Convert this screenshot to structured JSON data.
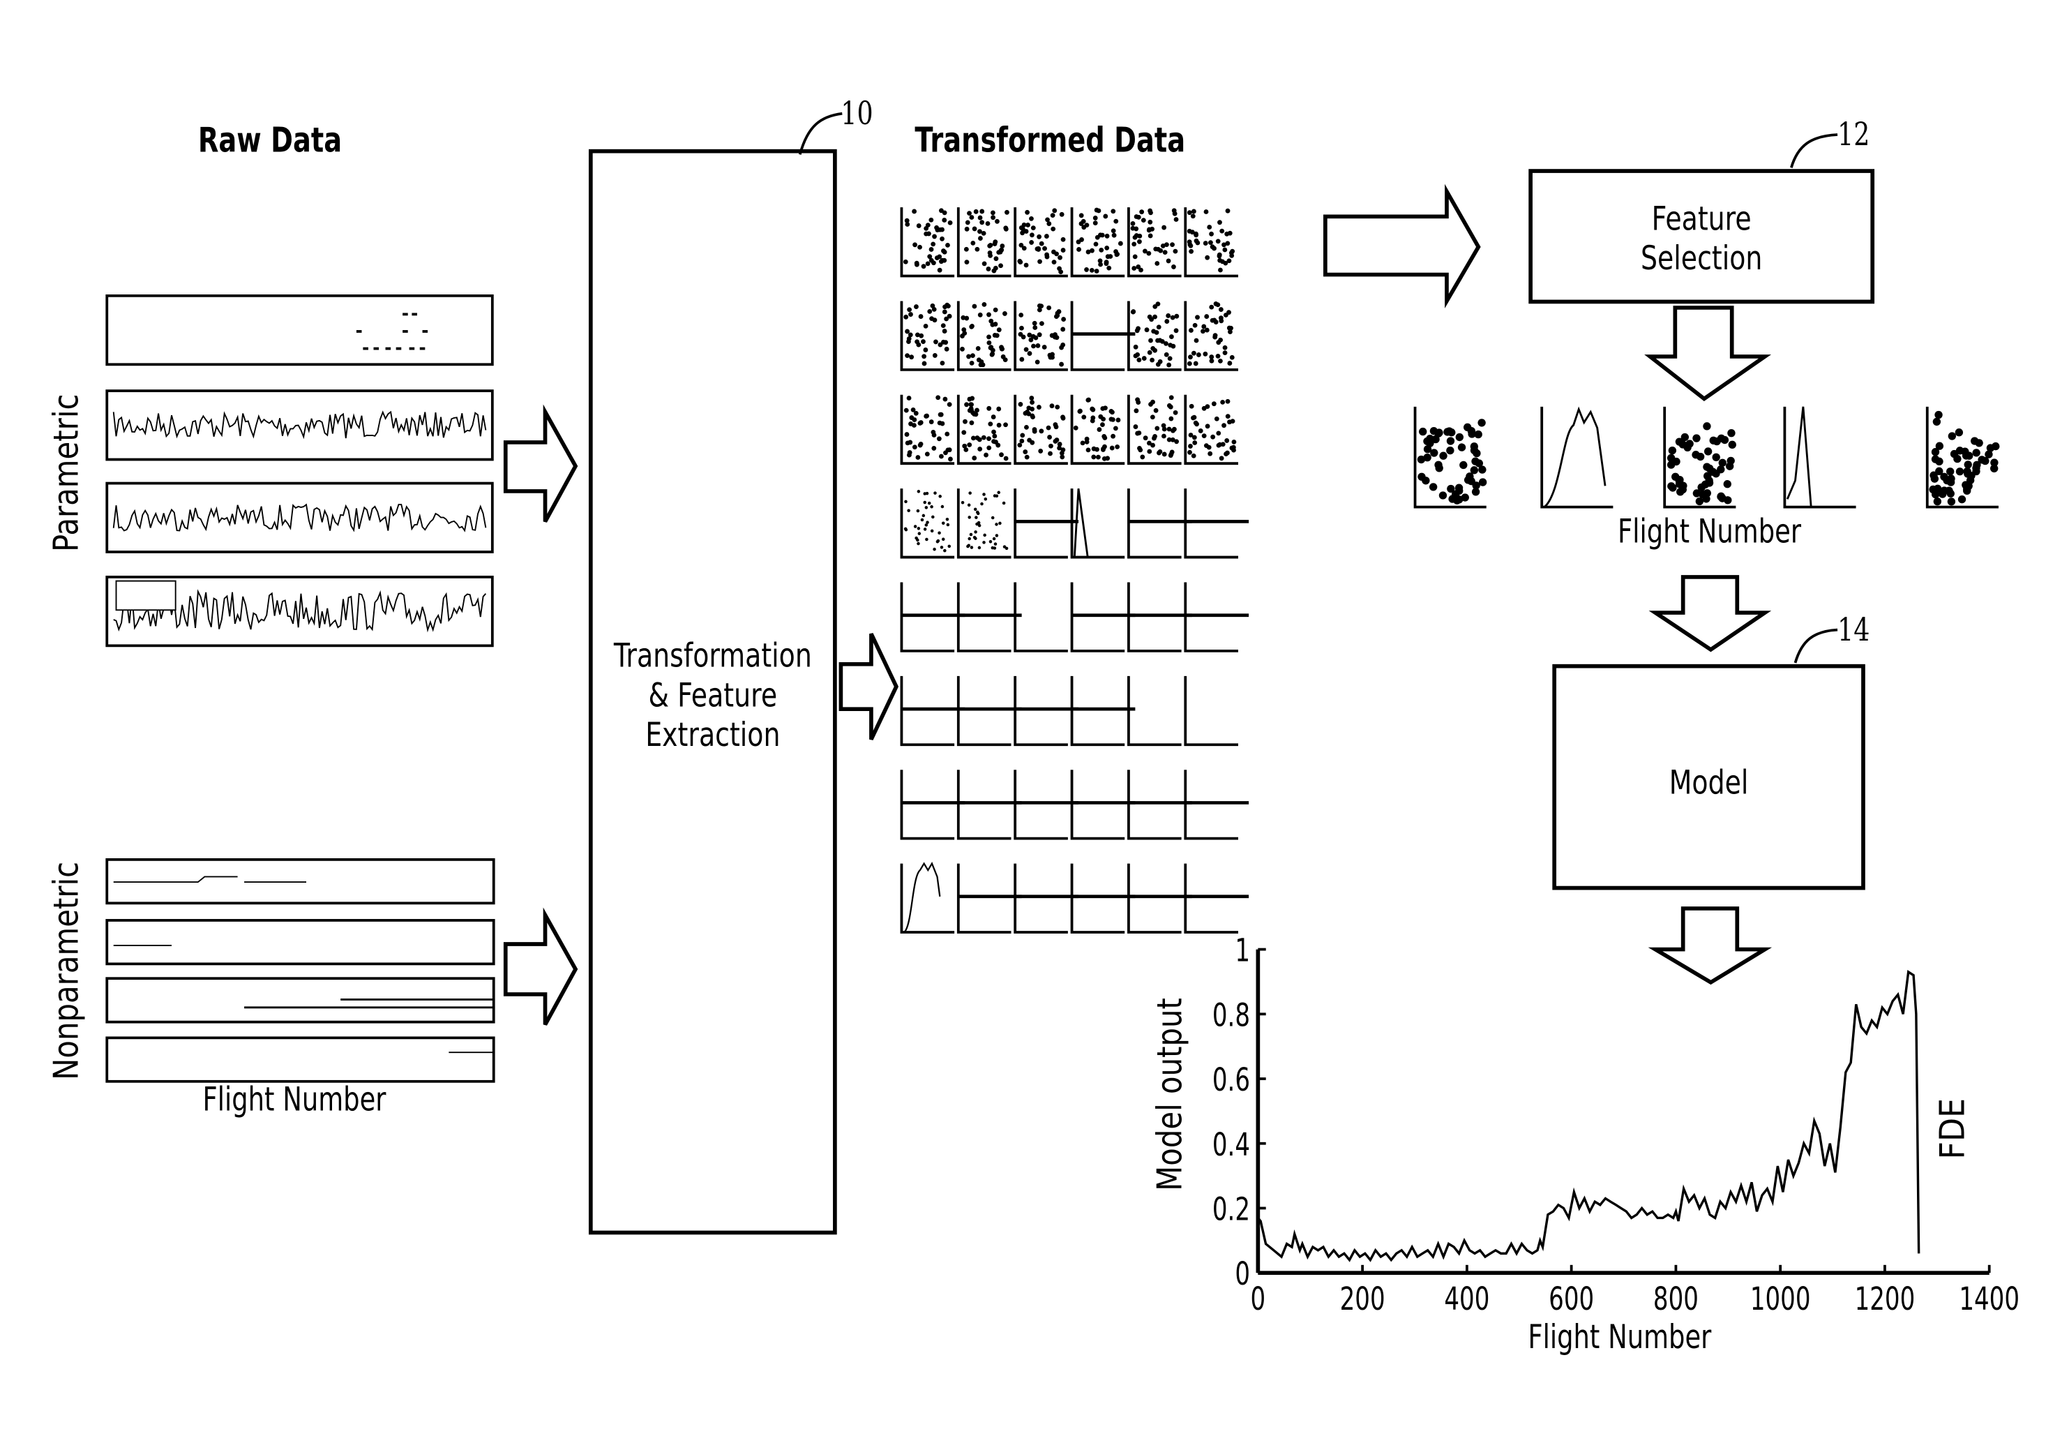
{
  "raw_data": {
    "title": "Raw Data",
    "parametric_label": "Parametric",
    "nonparametric_label": "Nonparametric",
    "xlabel": "Flight Number",
    "parametric_panels": 4,
    "nonparametric_panels": 4
  },
  "transform_block": {
    "ref": "10",
    "lines": [
      "Transformation",
      "& Feature",
      "Extraction"
    ]
  },
  "transformed_data": {
    "title": "Transformed Data",
    "grid_rows": 8,
    "grid_cols": 6,
    "cells": [
      [
        "scatter",
        "scatter",
        "scatter",
        "scatter",
        "scatter",
        "scatter"
      ],
      [
        "scatter",
        "scatter",
        "scatter",
        "flat",
        "scatter",
        "scatter"
      ],
      [
        "scatter",
        "scatter",
        "scatter",
        "scatter",
        "scatter",
        "scatter"
      ],
      [
        "noisy",
        "noisy",
        "flat",
        "spike",
        "flat",
        "flat"
      ],
      [
        "flat",
        "flat",
        "empty",
        "flat",
        "flat",
        "flat"
      ],
      [
        "flat",
        "flat",
        "flat",
        "flat",
        "empty",
        "empty"
      ],
      [
        "flat",
        "flat",
        "flat",
        "flat",
        "flat",
        "flat"
      ],
      [
        "hump",
        "flat",
        "flat",
        "flat",
        "flat",
        "flat"
      ]
    ]
  },
  "feature_selection": {
    "ref": "12",
    "lines": [
      "Feature",
      "Selection"
    ],
    "selected_features": [
      "scatter",
      "hump",
      "scatter",
      "spike",
      "scatter"
    ],
    "xlabel": "Flight Number"
  },
  "model": {
    "ref": "14",
    "label": "Model"
  },
  "chart_data": {
    "type": "line",
    "title": "",
    "xlabel": "Flight Number",
    "ylabel": "Model output",
    "xlim": [
      0,
      1400
    ],
    "ylim": [
      0,
      1
    ],
    "xticks": [
      "0",
      "200",
      "400",
      "600",
      "800",
      "1000",
      "1200",
      "1400"
    ],
    "yticks": [
      "0",
      "0.2",
      "0.4",
      "0.6",
      "0.8",
      "1"
    ],
    "annotation": "FDE",
    "annotation_x": 1275,
    "grid": false,
    "series": [
      {
        "name": "Model output",
        "x": [
          0,
          5,
          15,
          30,
          45,
          55,
          65,
          70,
          80,
          85,
          95,
          105,
          115,
          125,
          135,
          145,
          155,
          165,
          175,
          185,
          195,
          205,
          215,
          225,
          235,
          245,
          255,
          265,
          275,
          285,
          295,
          305,
          315,
          325,
          335,
          345,
          355,
          365,
          375,
          385,
          395,
          405,
          415,
          425,
          435,
          445,
          455,
          465,
          475,
          485,
          495,
          505,
          515,
          525,
          535,
          540,
          545,
          555,
          565,
          575,
          585,
          595,
          605,
          615,
          625,
          635,
          645,
          655,
          665,
          675,
          685,
          695,
          705,
          715,
          725,
          735,
          745,
          755,
          765,
          775,
          785,
          795,
          800,
          805,
          815,
          825,
          835,
          845,
          855,
          865,
          875,
          885,
          895,
          905,
          915,
          925,
          935,
          945,
          955,
          965,
          975,
          985,
          995,
          1005,
          1015,
          1025,
          1035,
          1045,
          1055,
          1065,
          1075,
          1085,
          1095,
          1105,
          1115,
          1125,
          1135,
          1145,
          1155,
          1165,
          1175,
          1185,
          1195,
          1205,
          1215,
          1225,
          1235,
          1245,
          1255,
          1260,
          1265,
          1270,
          1275
        ],
        "y": [
          0.17,
          0.16,
          0.09,
          0.07,
          0.05,
          0.09,
          0.08,
          0.12,
          0.07,
          0.09,
          0.05,
          0.08,
          0.07,
          0.08,
          0.05,
          0.07,
          0.05,
          0.06,
          0.04,
          0.07,
          0.05,
          0.06,
          0.04,
          0.07,
          0.05,
          0.06,
          0.04,
          0.06,
          0.07,
          0.05,
          0.08,
          0.05,
          0.06,
          0.07,
          0.05,
          0.09,
          0.05,
          0.09,
          0.08,
          0.06,
          0.1,
          0.07,
          0.06,
          0.07,
          0.05,
          0.06,
          0.07,
          0.06,
          0.06,
          0.09,
          0.06,
          0.09,
          0.07,
          0.06,
          0.07,
          0.1,
          0.08,
          0.18,
          0.19,
          0.21,
          0.2,
          0.17,
          0.25,
          0.2,
          0.23,
          0.19,
          0.22,
          0.21,
          0.23,
          0.22,
          0.21,
          0.2,
          0.19,
          0.17,
          0.18,
          0.2,
          0.18,
          0.19,
          0.17,
          0.17,
          0.18,
          0.17,
          0.19,
          0.16,
          0.26,
          0.22,
          0.24,
          0.2,
          0.23,
          0.18,
          0.17,
          0.22,
          0.2,
          0.25,
          0.22,
          0.27,
          0.22,
          0.28,
          0.19,
          0.24,
          0.26,
          0.22,
          0.33,
          0.25,
          0.35,
          0.3,
          0.34,
          0.4,
          0.37,
          0.47,
          0.43,
          0.33,
          0.4,
          0.31,
          0.45,
          0.62,
          0.65,
          0.83,
          0.76,
          0.74,
          0.78,
          0.76,
          0.82,
          0.8,
          0.84,
          0.86,
          0.8,
          0.93,
          0.92,
          0.8,
          0.06
        ]
      }
    ]
  }
}
